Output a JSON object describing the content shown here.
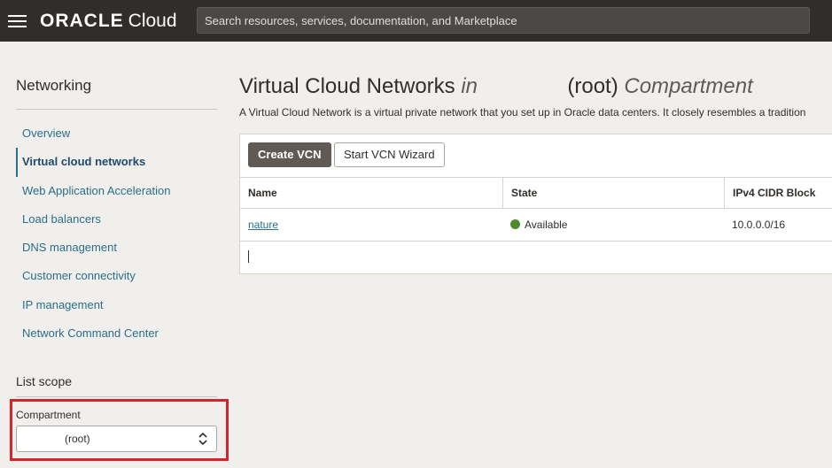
{
  "header": {
    "brand": "ORACLE",
    "product": "Cloud",
    "search_placeholder": "Search resources, services, documentation, and Marketplace"
  },
  "sidebar": {
    "title": "Networking",
    "items": [
      {
        "label": "Overview"
      },
      {
        "label": "Virtual cloud networks",
        "active": true
      },
      {
        "label": "Web Application Acceleration"
      },
      {
        "label": "Load balancers"
      },
      {
        "label": "DNS management"
      },
      {
        "label": "Customer connectivity"
      },
      {
        "label": "IP management"
      },
      {
        "label": "Network Command Center"
      }
    ],
    "scope_title": "List scope",
    "compartment_label": "Compartment",
    "compartment_value": "(root)"
  },
  "main": {
    "title_prefix": "Virtual Cloud Networks",
    "title_in": "in",
    "title_compartment": "(root)",
    "title_suffix": "Compartment",
    "description": "A Virtual Cloud Network is a virtual private network that you set up in Oracle data centers. It closely resembles a tradition",
    "create_button": "Create VCN",
    "wizard_button": "Start VCN Wizard",
    "columns": [
      "Name",
      "State",
      "IPv4 CIDR Block"
    ],
    "rows": [
      {
        "name": "nature",
        "state": "Available",
        "cidr": "10.0.0.0/16"
      }
    ]
  },
  "colors": {
    "topbar": "#312d2a",
    "link": "#2a6e8a",
    "available": "#4c8a2d",
    "highlight": "#d5242a"
  }
}
